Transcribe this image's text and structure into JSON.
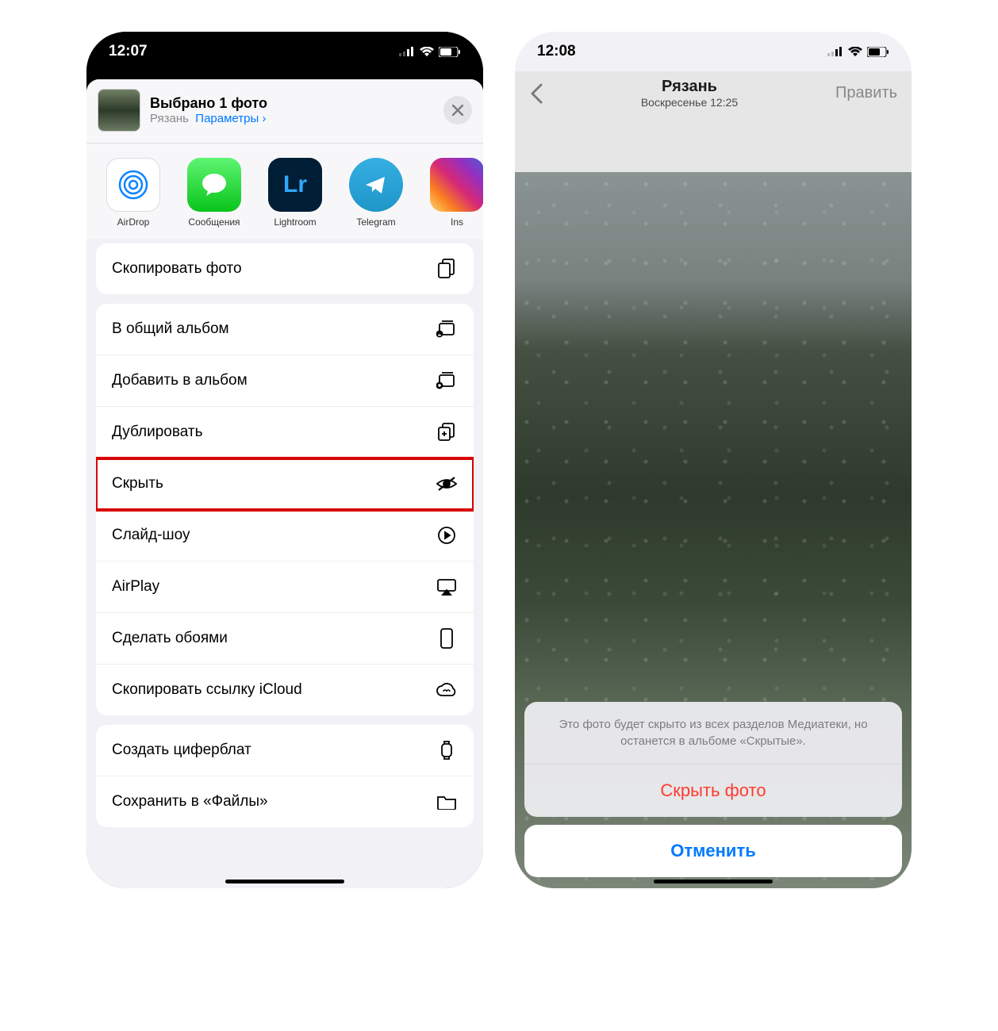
{
  "left": {
    "status_time": "12:07",
    "header_title": "Выбрано 1 фото",
    "header_location": "Рязань",
    "header_params": "Параметры",
    "apps": [
      {
        "label": "AirDrop"
      },
      {
        "label": "Сообщения"
      },
      {
        "label": "Lightroom"
      },
      {
        "label": "Telegram"
      },
      {
        "label": "Ins"
      }
    ],
    "actions": {
      "copy": "Скопировать фото",
      "shared_album": "В общий альбом",
      "add_album": "Добавить в альбом",
      "duplicate": "Дублировать",
      "hide": "Скрыть",
      "slideshow": "Слайд-шоу",
      "airplay": "AirPlay",
      "wallpaper": "Сделать обоями",
      "icloud_link": "Скопировать ссылку iCloud",
      "watch_face": "Создать циферблат",
      "save_files": "Сохранить в «Файлы»"
    }
  },
  "right": {
    "status_time": "12:08",
    "nav_title": "Рязань",
    "nav_sub": "Воскресенье 12:25",
    "nav_edit": "Править",
    "sheet_message": "Это фото будет скрыто из всех разделов Медиатеки, но останется в альбоме «Скрытые».",
    "hide_button": "Скрыть фото",
    "cancel_button": "Отменить"
  }
}
